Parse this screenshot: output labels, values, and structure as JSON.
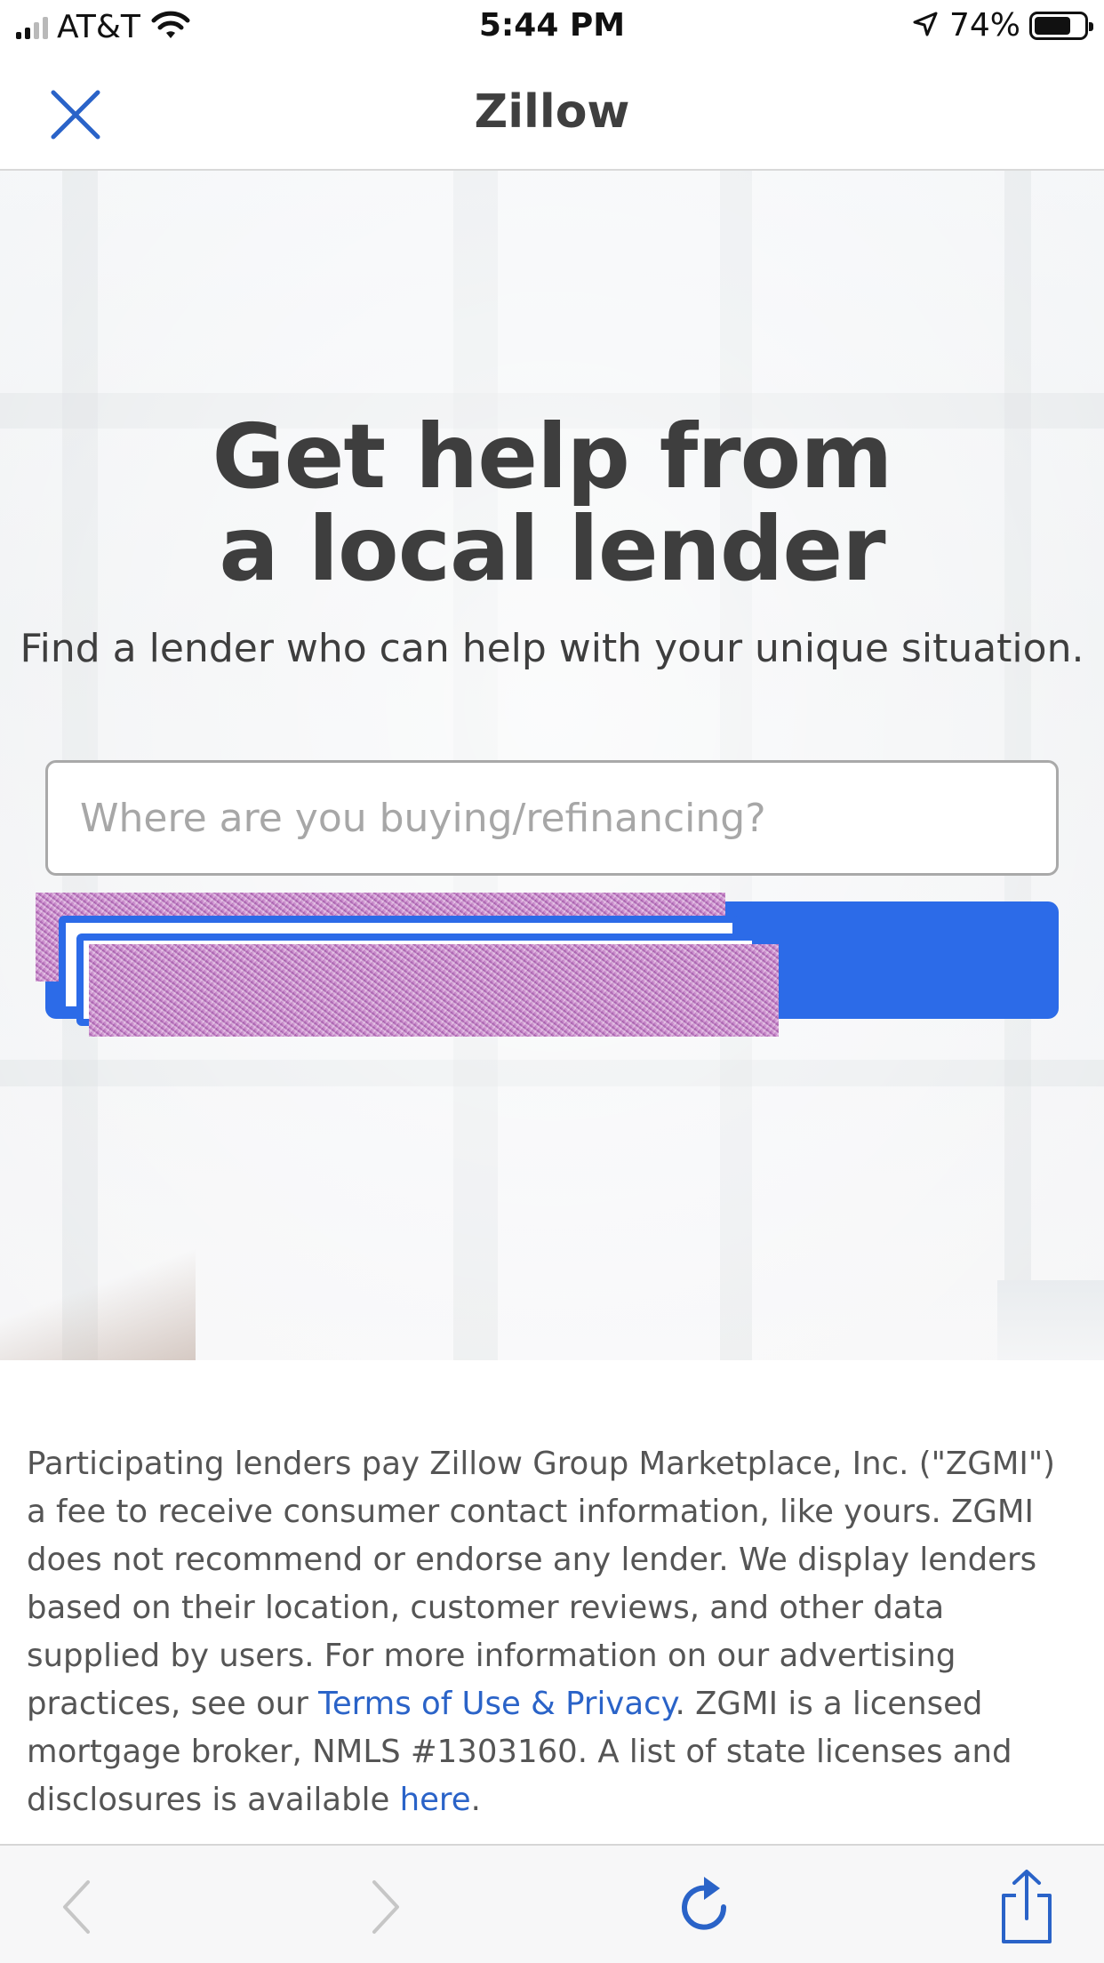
{
  "status_bar": {
    "carrier": "AT&T",
    "time": "5:44 PM",
    "battery_percent": "74%",
    "battery_level": 0.74,
    "signal_bars": 2,
    "wifi": "wifi-icon",
    "location": "location-arrow-icon"
  },
  "navbar": {
    "title": "Zillow",
    "close_icon": "close-icon"
  },
  "hero": {
    "title": "Get help from a local lender",
    "subtitle": "Find a lender who can help with your unique situation.",
    "search_placeholder": "Where are you buying/refinancing?",
    "search_value": "",
    "button_label": ""
  },
  "disclaimer": {
    "text_1": "Participating lenders pay Zillow Group Marketplace, Inc. (\"ZGMI\") a fee to receive consumer contact information, like yours. ZGMI does not recommend or endorse any lender. We display lenders based on their location, customer reviews, and other data supplied by users. For more information on our advertising practices, see our ",
    "link_terms": "Terms of Use & Privacy",
    "text_2": ". ZGMI is a licensed mortgage broker, NMLS #1303160. A list of state licenses and disclosures is available ",
    "link_here": "here",
    "text_3": "."
  },
  "toolbar": {
    "back_icon": "chevron-left-icon",
    "forward_icon": "chevron-right-icon",
    "reload_icon": "reload-icon",
    "share_icon": "share-icon"
  },
  "colors": {
    "accent": "#2c6be8",
    "link": "#2a63c8",
    "text": "#3e3e3e"
  }
}
